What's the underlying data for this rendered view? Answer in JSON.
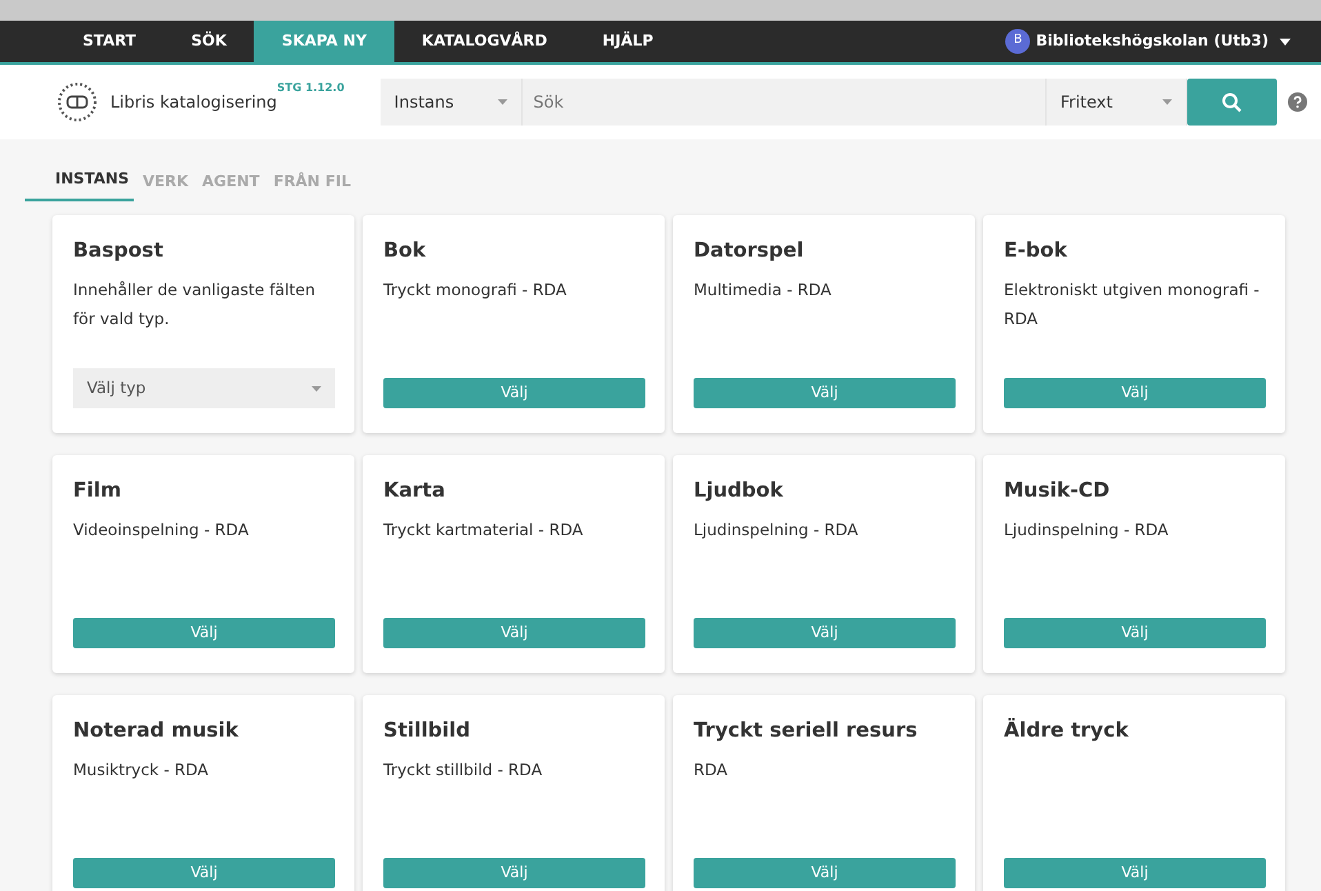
{
  "nav": {
    "items": [
      {
        "label": "START",
        "selected": false
      },
      {
        "label": "SÖK",
        "selected": false
      },
      {
        "label": "SKAPA NY",
        "selected": true
      },
      {
        "label": "KATALOGVÅRD",
        "selected": false
      },
      {
        "label": "HJÄLP",
        "selected": false
      }
    ],
    "user": {
      "initial": "B",
      "name": "Bibliotekshögskolan (Utb3)"
    }
  },
  "header": {
    "app_name": "Libris katalogisering",
    "version": "STG 1.12.0",
    "search": {
      "scope": "Instans",
      "placeholder": "Sök",
      "mode": "Fritext"
    }
  },
  "tabs": [
    {
      "label": "INSTANS",
      "selected": true
    },
    {
      "label": "VERK",
      "selected": false
    },
    {
      "label": "AGENT",
      "selected": false
    },
    {
      "label": "FRÅN FIL",
      "selected": false
    }
  ],
  "cards": [
    {
      "kind": "select",
      "title": "Baspost",
      "description": "Innehåller de vanligaste fälten för vald typ.",
      "control": "Välj typ"
    },
    {
      "kind": "button",
      "title": "Bok",
      "description": "Tryckt monografi - RDA",
      "control": "Välj"
    },
    {
      "kind": "button",
      "title": "Datorspel",
      "description": "Multimedia - RDA",
      "control": "Välj"
    },
    {
      "kind": "button",
      "title": "E-bok",
      "description": "Elektroniskt utgiven monografi - RDA",
      "control": "Välj"
    },
    {
      "kind": "button",
      "title": "Film",
      "description": "Videoinspelning - RDA",
      "control": "Välj"
    },
    {
      "kind": "button",
      "title": "Karta",
      "description": "Tryckt kartmaterial - RDA",
      "control": "Välj"
    },
    {
      "kind": "button",
      "title": "Ljudbok",
      "description": "Ljudinspelning - RDA",
      "control": "Välj"
    },
    {
      "kind": "button",
      "title": "Musik-CD",
      "description": "Ljudinspelning - RDA",
      "control": "Välj"
    },
    {
      "kind": "button",
      "title": "Noterad musik",
      "description": "Musiktryck - RDA",
      "control": "Välj"
    },
    {
      "kind": "button",
      "title": "Stillbild",
      "description": "Tryckt stillbild - RDA",
      "control": "Välj"
    },
    {
      "kind": "button",
      "title": "Tryckt seriell resurs",
      "description": "RDA",
      "control": "Välj"
    },
    {
      "kind": "button",
      "title": "Äldre tryck",
      "control": "Välj"
    }
  ]
}
